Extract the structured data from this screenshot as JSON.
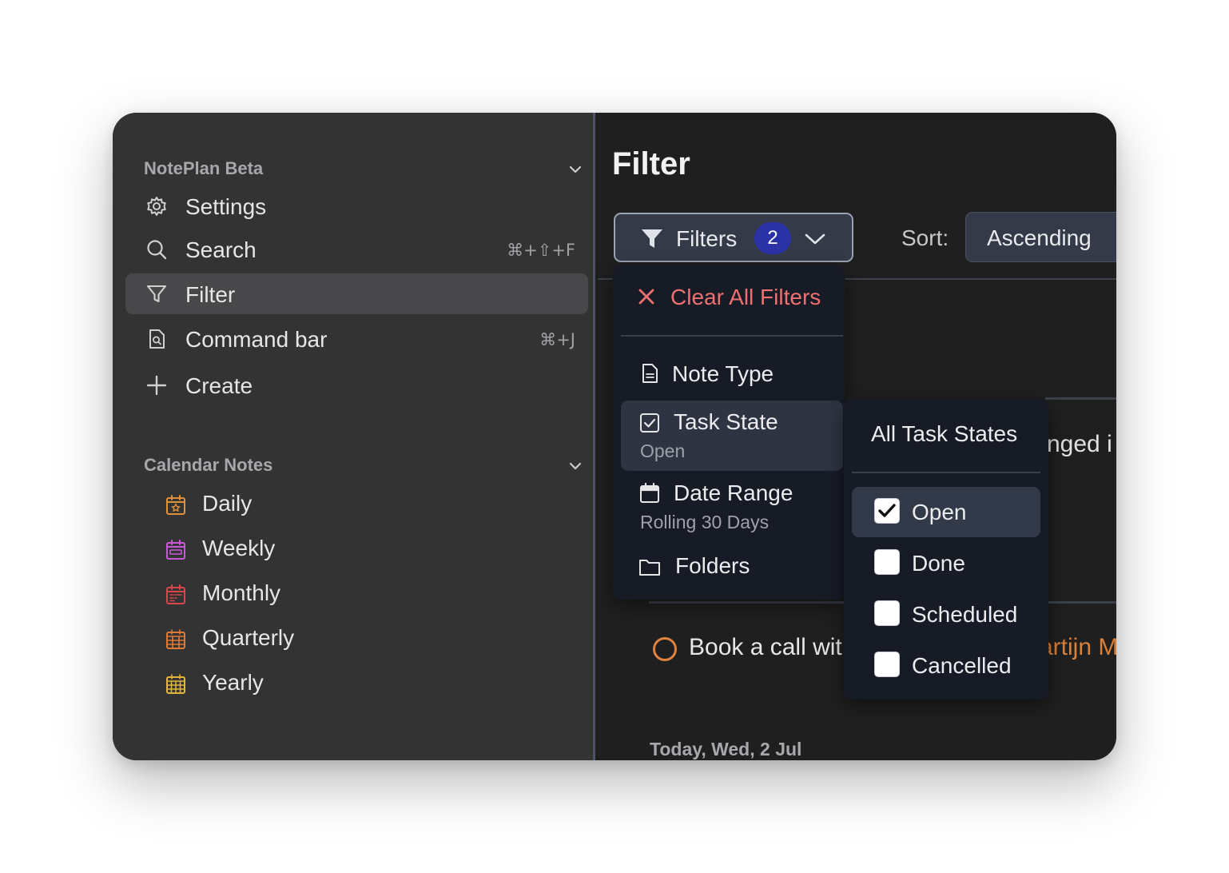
{
  "sidebar": {
    "section_title": "NotePlan Beta",
    "items": [
      {
        "label": "Settings",
        "shortcut": ""
      },
      {
        "label": "Search",
        "shortcut": "⌘+⇧+F"
      },
      {
        "label": "Filter",
        "shortcut": ""
      },
      {
        "label": "Command bar",
        "shortcut": "⌘+J"
      },
      {
        "label": "Create",
        "shortcut": ""
      }
    ],
    "calendar_section_title": "Calendar Notes",
    "calendar_items": [
      {
        "label": "Daily",
        "color": "#e0923a"
      },
      {
        "label": "Weekly",
        "color": "#c85ad8"
      },
      {
        "label": "Monthly",
        "color": "#d8474a"
      },
      {
        "label": "Quarterly",
        "color": "#df7a36"
      },
      {
        "label": "Yearly",
        "color": "#e3b53a"
      }
    ]
  },
  "main": {
    "title": "Filter",
    "filters_button": {
      "label": "Filters",
      "count": "2"
    },
    "sort": {
      "label": "Sort:",
      "value": "Ascending"
    },
    "background_fragment": "nged i",
    "task": {
      "text": "Book a call wit",
      "link_fragment": "artijn M"
    },
    "date_header": "Today, Wed, 2 Jul"
  },
  "filter_menu": {
    "clear_label": "Clear All Filters",
    "items": [
      {
        "label": "Note Type",
        "sub": ""
      },
      {
        "label": "Task State",
        "sub": "Open"
      },
      {
        "label": "Date Range",
        "sub": "Rolling 30 Days"
      },
      {
        "label": "Folders",
        "sub": ""
      }
    ]
  },
  "task_state_menu": {
    "header": "All Task States",
    "options": [
      {
        "label": "Open",
        "checked": true
      },
      {
        "label": "Done",
        "checked": false
      },
      {
        "label": "Scheduled",
        "checked": false
      },
      {
        "label": "Cancelled",
        "checked": false
      }
    ]
  },
  "colors": {
    "accent_badge": "#2b32a6",
    "clear_red": "#ee7070",
    "task_orange": "#e0823d"
  }
}
